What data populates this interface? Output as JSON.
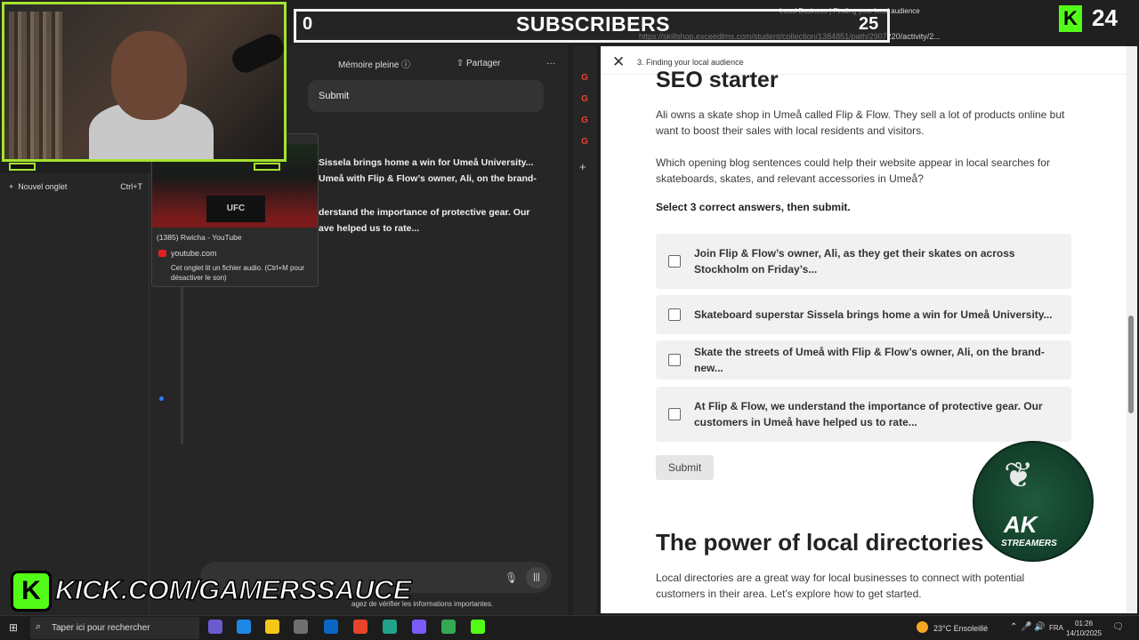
{
  "overlay": {
    "subs_left_count": "0",
    "subs_title": "SUBSCRIBERS",
    "subs_right_count": "25",
    "kick_count": "24",
    "kick_banner": "KICK.COM/GAMERSSAUCE",
    "kick_k": "K",
    "ak_text": "AK",
    "ak_sub": "STREAMERS"
  },
  "left_browser": {
    "new_tab_label": "Nouvel onglet",
    "new_tab_shortcut": "Ctrl+T",
    "chat_memory_label": "Mémoire pleine",
    "share_label": "Partager",
    "more_label": "···",
    "submit_bubble": "Submit",
    "chat_lines": [
      "Sissela brings home a win for Umeå University...",
      "Umeå with Flip & Flow’s owner, Ali, on the brand-",
      "derstand the importance of protective gear. Our",
      "ave helped us to rate..."
    ],
    "disclaimer": "agez de vérifier les informations importantes."
  },
  "tab_preview": {
    "title": "(1385) Rwicha - YouTube",
    "host": "youtube.com",
    "audio_note": "Cet onglet lit un fichier audio. (Ctrl+M pour désactiver le son)",
    "thumb_logo": "UFC"
  },
  "right_browser": {
    "tab_title": "Local Business | Finding your local audience",
    "url": "https://skillshop.exceedlms.com/student/collection/1384851/path/2907220/activity/2..."
  },
  "course": {
    "breadcrumb": "3. Finding your local audience",
    "section_title": "SEO starter",
    "intro": "Ali owns a skate shop in Umeå called Flip & Flow. They sell a lot of products online but want to boost their sales with local residents and visitors.",
    "question": "Which opening blog sentences could help their website appear in local searches for skateboards, skates, and relevant accessories in Umeå?",
    "instruction": "Select 3 correct answers, then submit.",
    "options": [
      "Join Flip & Flow’s owner, Ali, as they get their skates on across Stockholm on Friday’s...",
      "Skateboard superstar Sissela brings home a win for Umeå University...",
      "Skate the streets of Umeå with Flip & Flow’s owner, Ali, on the brand-new...",
      "At Flip & Flow, we understand the importance of protective gear. Our customers in Umeå have helped us to rate..."
    ],
    "submit_label": "Submit",
    "next_title": "The power of local directories",
    "next_para": "Local directories are a great way for local businesses to connect with potential customers in their area. Let’s explore how to get started."
  },
  "taskbar": {
    "search_placeholder": "Taper ici pour rechercher",
    "weather": "23°C  Ensoleillé",
    "lang": "FRA",
    "time": "01:26",
    "date": "14/10/2025"
  }
}
